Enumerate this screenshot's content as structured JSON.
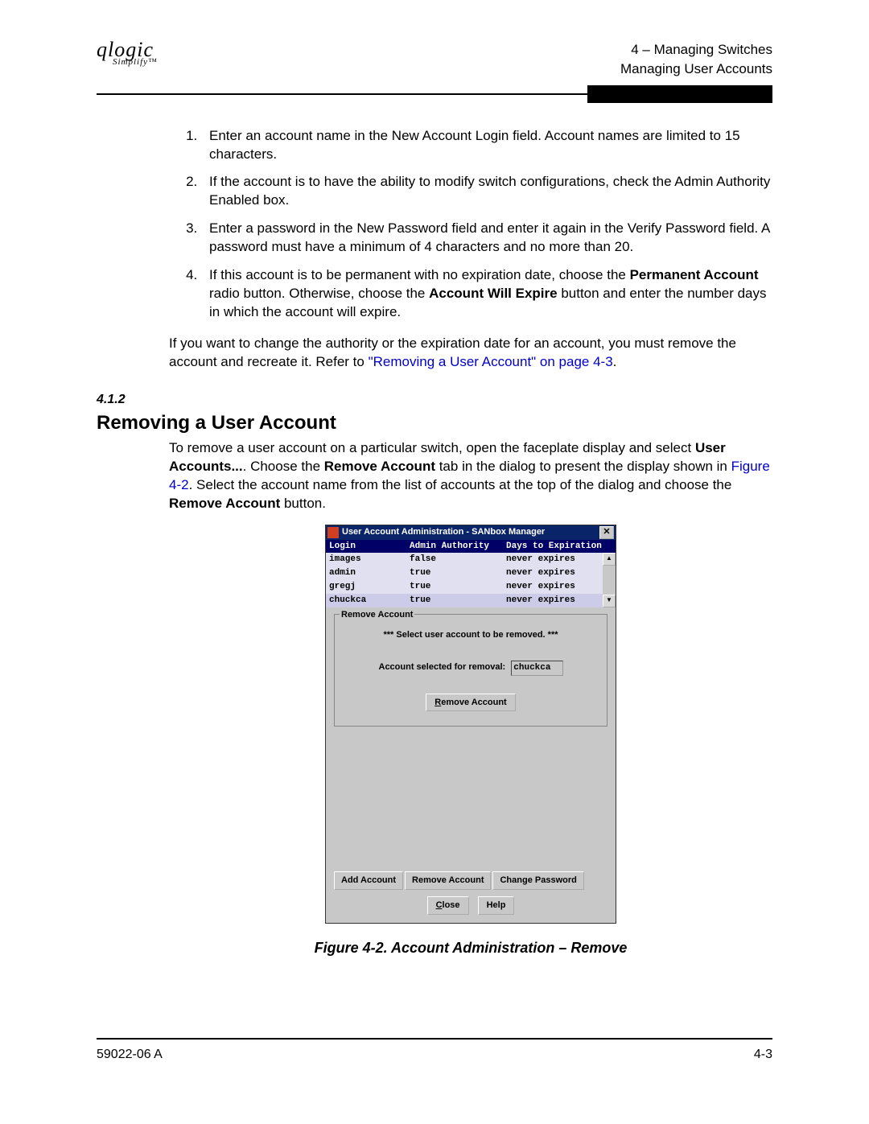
{
  "header": {
    "logo_line1": "qlogic",
    "logo_line2": "Simplify™",
    "right_line1": "4 – Managing Switches",
    "right_line2": "Managing User Accounts"
  },
  "steps": {
    "s1": "Enter an account name in the New Account Login field. Account names are limited to 15 characters.",
    "s2": "If the account is to have the ability to modify switch configurations, check the Admin Authority Enabled box.",
    "s3": "Enter a password in the New Password field and enter it again in the Verify Password field. A password must have a minimum of 4 characters and no more than 20.",
    "s4_a": "If this account is to be permanent with no expiration date, choose the ",
    "s4_b": "Permanent Account",
    "s4_c": " radio button. Otherwise, choose the ",
    "s4_d": "Account Will Expire",
    "s4_e": " button and enter the number days in which the account will expire."
  },
  "para1_a": "If you want to change the authority or the expiration date for an account, you must remove the account and recreate it. Refer to ",
  "para1_link": "\"Removing a User Account\" on page 4-3",
  "para1_b": ".",
  "sectnum": "4.1.2",
  "section_title": "Removing a User Account",
  "para2_a": "To remove a user account on a particular switch, open the faceplate display and select ",
  "para2_b": "User Accounts...",
  "para2_c": ". Choose the ",
  "para2_d": "Remove Account",
  "para2_e": " tab in the dialog to present the display shown in ",
  "para2_link": "Figure 4-2",
  "para2_f": ". Select the account name from the list of accounts at the top of the dialog and choose the ",
  "para2_g": "Remove Account",
  "para2_h": " button.",
  "dialog": {
    "title": "User Account Administration - SANbox Manager",
    "close": "✕",
    "columns": {
      "c1": "Login",
      "c2": "Admin Authority",
      "c3": "Days to Expiration"
    },
    "rows": [
      {
        "login": "images",
        "admin": "false",
        "exp": "never expires"
      },
      {
        "login": "admin",
        "admin": "true",
        "exp": "never expires"
      },
      {
        "login": "gregj",
        "admin": "true",
        "exp": "never expires"
      },
      {
        "login": "chuckca",
        "admin": "true",
        "exp": "never expires"
      }
    ],
    "scroll_up": "▲",
    "scroll_down": "▼",
    "group_title": "Remove Account",
    "prompt": "*** Select user account to be removed. ***",
    "selected_label": "Account selected for removal:",
    "selected_value": "chuckca",
    "remove_btn_u": "R",
    "remove_btn_rest": "emove Account",
    "tabs": {
      "add": "Add Account",
      "remove": "Remove Account",
      "change": "Change Password"
    },
    "close_btn_u": "C",
    "close_btn_rest": "lose",
    "help_btn": "Help"
  },
  "figure_caption": "Figure 4-2.  Account Administration – Remove",
  "footer": {
    "left": "59022-06  A",
    "right": "4-3"
  }
}
